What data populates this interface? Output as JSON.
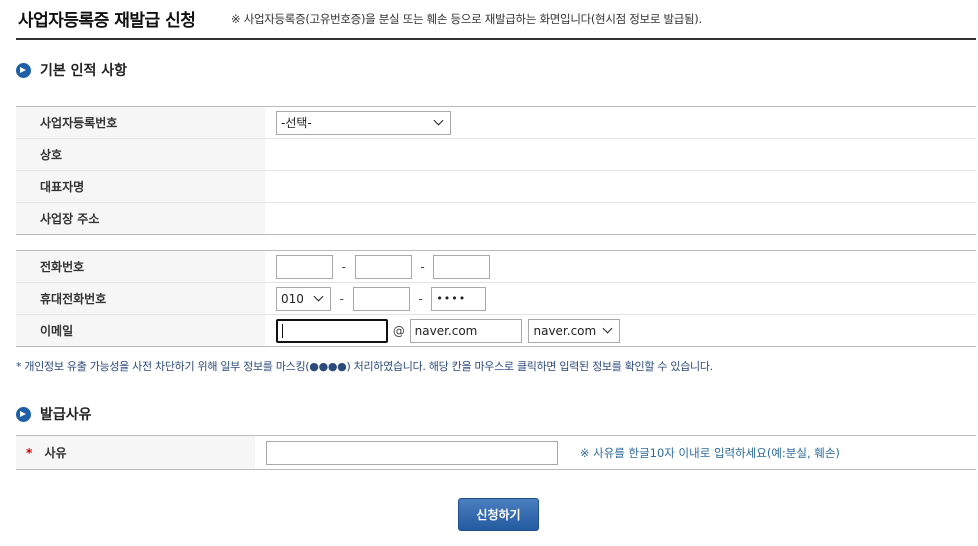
{
  "header": {
    "title": "사업자등록증 재발급 신청",
    "description": "※ 사업자등록증(고유번호증)을 분실 또는 훼손 등으로 재발급하는 화면입니다(현시점 정보로 발급됨)."
  },
  "basic_section": {
    "title": "기본 인적 사항",
    "rows": {
      "biz_no_label": "사업자등록번호",
      "biz_no_select": "-선택-",
      "company_label": "상호",
      "ceo_label": "대표자명",
      "address_label": "사업장 주소"
    }
  },
  "contact": {
    "phone_label": "전화번호",
    "phone_sep": "-",
    "mobile_label": "휴대전화번호",
    "mobile_prefix": "010",
    "mobile_last": "••••",
    "email_label": "이메일",
    "email_at": "@",
    "email_domain": "naver.com",
    "email_domain_select": "naver.com"
  },
  "notice": "* 개인정보 유출 가능성을 사전 차단하기 위해 일부 정보를 마스킹(●●●●) 처리하였습니다. 해당 칸을 마우스로 클릭하면 입력된 정보를 확인할 수 있습니다.",
  "reason_section": {
    "title": "발급사유",
    "required_mark": "*",
    "reason_label": "사유",
    "hint": "※ 사유를 한글10자 이내로 입력하세요(예:분실, 훼손)"
  },
  "submit_label": "신청하기"
}
